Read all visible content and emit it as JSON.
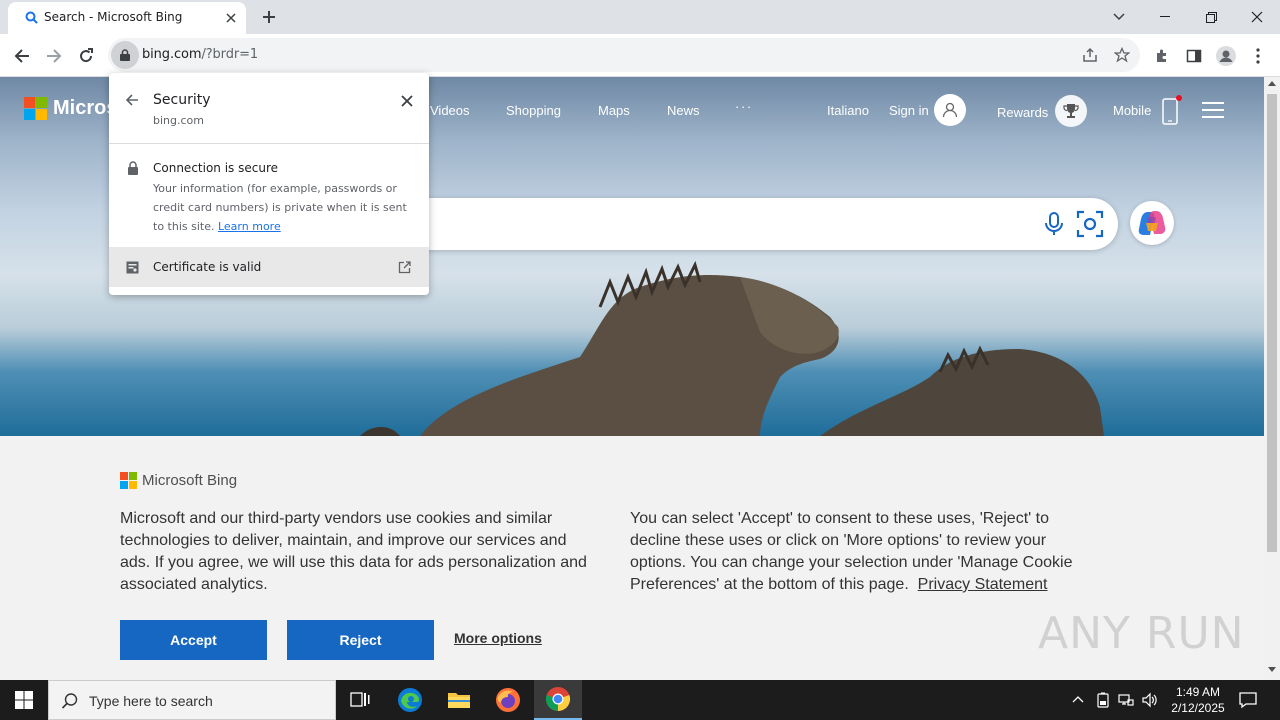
{
  "browser": {
    "tab_title": "Search - Microsoft Bing",
    "url_host": "bing.com",
    "url_rest": "/?brdr=1"
  },
  "bing": {
    "logo_text": "Microsoft",
    "nav": [
      "Videos",
      "Shopping",
      "Maps",
      "News",
      "· · ·"
    ],
    "language": "Italiano",
    "sign_in": "Sign in",
    "rewards": "Rewards",
    "mobile": "Mobile"
  },
  "cookie": {
    "logo_text": "Microsoft Bing",
    "para1": "Microsoft and our third-party vendors use cookies and similar technologies to deliver, maintain, and improve our services and ads. If you agree, we will use this data for ads personalization and associated analytics.",
    "para2": "You can select 'Accept' to consent to these uses, 'Reject' to decline these uses or click on 'More options' to review your options. You can change your selection under 'Manage Cookie Preferences' at the bottom of this page.",
    "privacy_link": "Privacy Statement",
    "accept": "Accept",
    "reject": "Reject",
    "more_options": "More options"
  },
  "security_popup": {
    "title": "Security",
    "subtitle": "bing.com",
    "connection_title": "Connection is secure",
    "connection_desc": "Your information (for example, passwords or credit card numbers) is private when it is sent to this site.",
    "learn_more": "Learn more",
    "certificate": "Certificate is valid"
  },
  "watermark": "ANY RUN",
  "taskbar": {
    "search_placeholder": "Type here to search",
    "time": "1:49 AM",
    "date": "2/12/2025"
  },
  "colors": {
    "accent_blue": "#1667c2",
    "link_blue": "#1a73e8",
    "ms_red": "#f25022",
    "ms_green": "#7fba00",
    "ms_blue": "#00a4ef",
    "ms_yellow": "#ffb900"
  }
}
